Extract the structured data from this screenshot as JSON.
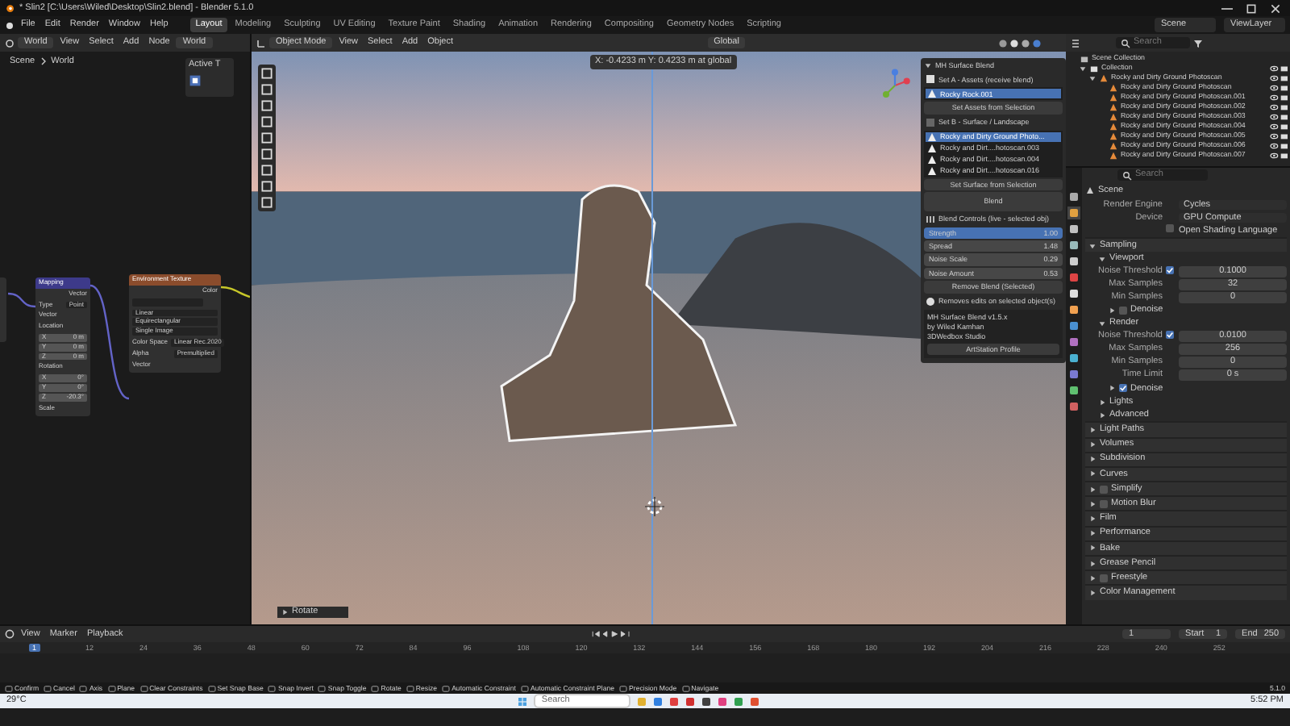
{
  "title_bar": {
    "title": "* Slin2 [C:\\Users\\Wiled\\Desktop\\Slin2.blend] - Blender 5.1.0"
  },
  "menu_bar": {
    "menus": [
      "File",
      "Edit",
      "Render",
      "Window",
      "Help"
    ],
    "workspaces": [
      {
        "label": "Layout",
        "selected": true
      },
      {
        "label": "Modeling",
        "selected": false
      },
      {
        "label": "Sculpting",
        "selected": false
      },
      {
        "label": "UV Editing",
        "selected": false
      },
      {
        "label": "Texture Paint",
        "selected": false
      },
      {
        "label": "Shading",
        "selected": false
      },
      {
        "label": "Animation",
        "selected": false
      },
      {
        "label": "Rendering",
        "selected": false
      },
      {
        "label": "Compositing",
        "selected": false
      },
      {
        "label": "Geometry Nodes",
        "selected": false
      },
      {
        "label": "Scripting",
        "selected": false
      }
    ],
    "scene": "Scene",
    "view_layer": "ViewLayer"
  },
  "node_editor": {
    "editor": "World",
    "menus": [
      "View",
      "Select",
      "Add",
      "Node"
    ],
    "world": "World",
    "breadcrumb": [
      "Scene",
      "World"
    ],
    "active_tool": "Active T",
    "nodes": [
      {
        "kind": "mapping",
        "title": "Mapping",
        "output": "Vector",
        "type_label": "Type",
        "type": "Point",
        "input": "Vector",
        "groups": [
          {
            "label": "Location",
            "values": [
              {
                "axis": "X",
                "value": "0 m"
              },
              {
                "axis": "Y",
                "value": "0 m"
              },
              {
                "axis": "Z",
                "value": "0 m"
              }
            ]
          },
          {
            "label": "Rotation",
            "values": [
              {
                "axis": "X",
                "value": "0°"
              },
              {
                "axis": "Y",
                "value": "0°"
              },
              {
                "axis": "Z",
                "value": "-20.3°"
              }
            ]
          },
          {
            "label": "Scale"
          }
        ]
      },
      {
        "kind": "environment",
        "title": "Environment Texture",
        "output": "Color",
        "options": [
          "Linear",
          "Equirectangular",
          "Single Image"
        ],
        "fields": [
          {
            "label": "Color Space",
            "value": "Linear Rec.2020"
          },
          {
            "label": "Alpha",
            "value": "Premultiplied"
          }
        ],
        "input": "Vector"
      }
    ]
  },
  "viewport": {
    "mode": "Object Mode",
    "menus": [
      "View",
      "Select",
      "Add",
      "Object"
    ],
    "orientation": "Global",
    "overlay_text": "X: -0.4233 m  Y: 0.4233 m  at global",
    "operator": "Rotate"
  },
  "n_panel": {
    "title": "MH Surface Blend",
    "expanded": true,
    "set_a": {
      "label": "Set A - Assets (receive blend)",
      "items": [
        {
          "label": "Rocky Rock.001",
          "selected": true
        }
      ],
      "button": "Set Assets from Selection"
    },
    "set_b": {
      "label": "Set B - Surface / Landscape",
      "items": [
        {
          "label": "Rocky and Dirty Ground Photo...",
          "selected": true
        },
        {
          "label": "Rocky and Dirt....hotoscan.003",
          "selected": false
        },
        {
          "label": "Rocky and Dirt....hotoscan.004",
          "selected": false
        },
        {
          "label": "Rocky and Dirt....hotoscan.016",
          "selected": false
        }
      ],
      "button": "Set Surface from Selection"
    },
    "blend_button": "Blend",
    "controls": {
      "title": "Blend Controls (live - selected obj)",
      "fields": [
        {
          "kind": "slider",
          "label": "Strength",
          "value": "1.00",
          "level": 1
        },
        {
          "kind": "number",
          "label": "Spread",
          "value": "1.48"
        },
        {
          "kind": "number",
          "label": "Noise Scale",
          "value": "0.29"
        },
        {
          "kind": "number",
          "label": "Noise Amount",
          "value": "0.53"
        }
      ]
    },
    "remove_button": "Remove Blend (Selected)",
    "note": "Removes edits on selected object(s)",
    "about": {
      "title": "MH Surface Blend v1.5.x",
      "author": "by Wiled Kamhan",
      "studio": "3DWedbox Studio",
      "link": "ArtStation Profile"
    }
  },
  "outliner": {
    "search_placeholder": "Search",
    "tree": [
      {
        "kind": "scene",
        "label": "Scene Collection",
        "children": [
          {
            "kind": "collection",
            "label": "Collection",
            "expanded": true,
            "children": [
              {
                "kind": "object",
                "label": "Rocky and Dirty Ground Photoscan",
                "expanded": true,
                "children": [
                  {
                    "kind": "mesh",
                    "label": "Rocky and Dirty Ground Photoscan"
                  },
                  {
                    "kind": "mesh",
                    "label": "Rocky and Dirty Ground Photoscan.001"
                  },
                  {
                    "kind": "mesh",
                    "label": "Rocky and Dirty Ground Photoscan.002"
                  },
                  {
                    "kind": "mesh",
                    "label": "Rocky and Dirty Ground Photoscan.003"
                  },
                  {
                    "kind": "mesh",
                    "label": "Rocky and Dirty Ground Photoscan.004"
                  },
                  {
                    "kind": "mesh",
                    "label": "Rocky and Dirty Ground Photoscan.005"
                  },
                  {
                    "kind": "mesh",
                    "label": "Rocky and Dirty Ground Photoscan.006"
                  },
                  {
                    "kind": "mesh",
                    "label": "Rocky and Dirty Ground Photoscan.007"
                  }
                ]
              }
            ]
          }
        ]
      }
    ]
  },
  "properties": {
    "search_placeholder": "Search",
    "context": "Scene",
    "settings": [
      {
        "label": "Render Engine",
        "value": "Cycles"
      },
      {
        "label": "Device",
        "value": "GPU Compute"
      }
    ],
    "osl": {
      "label": "Open Shading Language",
      "checked": false
    },
    "panels": [
      {
        "kind": "panel",
        "label": "Sampling",
        "expanded": true,
        "children": [
          {
            "kind": "panel",
            "label": "Viewport",
            "expanded": true,
            "children": [
              {
                "kind": "field",
                "label": "Noise Threshold",
                "checked": true,
                "value": "0.1000"
              },
              {
                "kind": "field",
                "label": "Max Samples",
                "value": "32"
              },
              {
                "kind": "field",
                "label": "Min Samples",
                "value": "0"
              },
              {
                "kind": "panel",
                "label": "Denoise",
                "expanded": false,
                "checked": false
              }
            ]
          },
          {
            "kind": "panel",
            "label": "Render",
            "expanded": true,
            "children": [
              {
                "kind": "field",
                "label": "Noise Threshold",
                "checked": true,
                "value": "0.0100"
              },
              {
                "kind": "field",
                "label": "Max Samples",
                "value": "256"
              },
              {
                "kind": "field",
                "label": "Min Samples",
                "value": "0"
              },
              {
                "kind": "field",
                "label": "Time Limit",
                "value": "0 s"
              },
              {
                "kind": "panel",
                "label": "Denoise",
                "expanded": false,
                "checked": true
              }
            ]
          },
          {
            "kind": "panel",
            "label": "Lights",
            "expanded": false
          },
          {
            "kind": "panel",
            "label": "Advanced",
            "expanded": false
          }
        ]
      },
      {
        "kind": "panel",
        "label": "Light Paths",
        "expanded": false
      },
      {
        "kind": "panel",
        "label": "Volumes",
        "expanded": false
      },
      {
        "kind": "panel",
        "label": "Subdivision",
        "expanded": false
      },
      {
        "kind": "panel",
        "label": "Curves",
        "expanded": false
      },
      {
        "kind": "panel",
        "label": "Simplify",
        "expanded": false,
        "checked": false
      },
      {
        "kind": "panel",
        "label": "Motion Blur",
        "expanded": false,
        "checked": false
      },
      {
        "kind": "panel",
        "label": "Film",
        "expanded": false
      },
      {
        "kind": "panel",
        "label": "Performance",
        "expanded": false
      },
      {
        "kind": "panel",
        "label": "Bake",
        "expanded": false
      },
      {
        "kind": "panel",
        "label": "Grease Pencil",
        "expanded": false
      },
      {
        "kind": "panel",
        "label": "Freestyle",
        "expanded": false,
        "checked": false
      },
      {
        "kind": "panel",
        "label": "Color Management",
        "expanded": false
      }
    ]
  },
  "timeline": {
    "menus": [
      "View",
      "Marker",
      "Playback"
    ],
    "current_frame": "1",
    "start_label": "Start",
    "start": "1",
    "end_label": "End",
    "end": "250",
    "ruler": [
      {
        "label": "1",
        "selected": true
      },
      {
        "label": "12",
        "selected": false
      },
      {
        "label": "24",
        "selected": false
      },
      {
        "label": "36",
        "selected": false
      },
      {
        "label": "48",
        "selected": false
      },
      {
        "label": "60",
        "selected": false
      },
      {
        "label": "72",
        "selected": false
      },
      {
        "label": "84",
        "selected": false
      },
      {
        "label": "96",
        "selected": false
      },
      {
        "label": "108",
        "selected": false
      },
      {
        "label": "120",
        "selected": false
      },
      {
        "label": "132",
        "selected": false
      },
      {
        "label": "144",
        "selected": false
      },
      {
        "label": "156",
        "selected": false
      },
      {
        "label": "168",
        "selected": false
      },
      {
        "label": "180",
        "selected": false
      },
      {
        "label": "192",
        "selected": false
      },
      {
        "label": "204",
        "selected": false
      },
      {
        "label": "216",
        "selected": false
      },
      {
        "label": "228",
        "selected": false
      },
      {
        "label": "240",
        "selected": false
      },
      {
        "label": "252",
        "selected": false
      }
    ]
  },
  "status_bar": {
    "hints": [
      "Confirm",
      "Cancel",
      "Axis",
      "Plane",
      "Clear Constraints",
      "Set Snap Base",
      "Snap Invert",
      "Snap Toggle",
      "Rotate",
      "Resize",
      "Automatic Constraint",
      "Automatic Constraint Plane",
      "Precision Mode",
      "Navigate"
    ],
    "version": "5.1.0"
  },
  "taskbar": {
    "weather": "29°C",
    "search_placeholder": "Search",
    "time": "5:52 PM"
  }
}
